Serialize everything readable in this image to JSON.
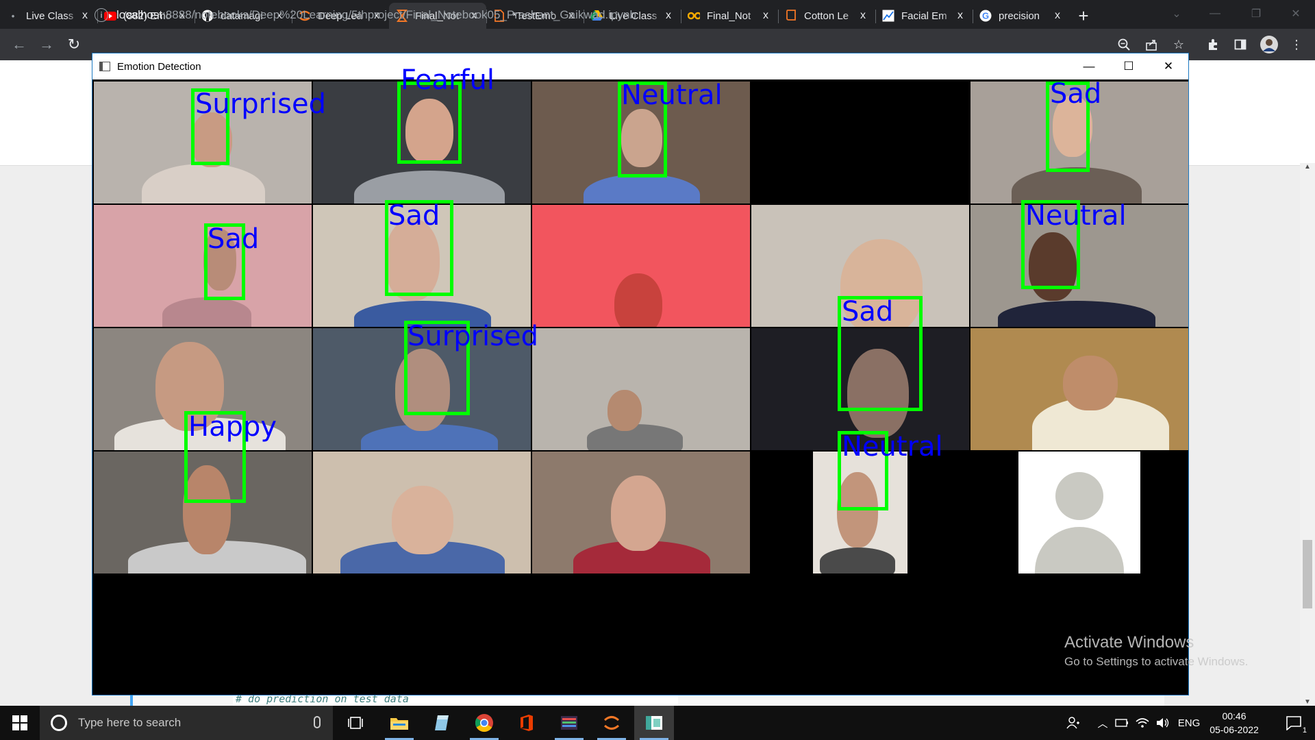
{
  "browser": {
    "tabs": [
      {
        "label": "Live Class",
        "icon": "live-class-icon"
      },
      {
        "label": "(882) Emo",
        "icon": "youtube-icon"
      },
      {
        "label": "datamagi",
        "icon": "github-icon"
      },
      {
        "label": "Deep Lea",
        "icon": "jupyter-icon"
      },
      {
        "label": "Final_Not",
        "icon": "jupyter-hourglass-icon",
        "active": true
      },
      {
        "label": "*TestEmo",
        "icon": "document-icon"
      },
      {
        "label": "Live Class",
        "icon": "google-drive-icon"
      },
      {
        "label": "Final_Not",
        "icon": "colab-icon"
      },
      {
        "label": "Cotton Le",
        "icon": "book-icon"
      },
      {
        "label": "Facial Em",
        "icon": "chart-icon"
      },
      {
        "label": "precision",
        "icon": "google-icon"
      }
    ],
    "new_tab_label": "+",
    "close_glyph": "x",
    "address_host": "localhost",
    "address_path": ":8888/notebooks/Deep%20Learning/5thproject/Final_Notebook05_Prashant_Gaikwad.ipynb"
  },
  "notebook": {
    "code_line": "# do prediction on test data"
  },
  "cv_window": {
    "title": "Emotion Detection",
    "detections": [
      {
        "label": "Surprised"
      },
      {
        "label": "Fearful"
      },
      {
        "label": "Neutral"
      },
      {
        "label": "Sad"
      },
      {
        "label": "Sad"
      },
      {
        "label": "Sad"
      },
      {
        "label": "Neutral"
      },
      {
        "label": "Sad"
      },
      {
        "label": "Surprised"
      },
      {
        "label": "Happy"
      },
      {
        "label": "Neutral"
      }
    ],
    "box_color": "#00ff00",
    "label_color": "#0000ff"
  },
  "watermark": {
    "line1": "Activate Windows",
    "line2": "Go to Settings to activate Windows."
  },
  "taskbar": {
    "search_placeholder": "Type here to search",
    "language": "ENG",
    "time": "00:46",
    "date": "05-06-2022",
    "notification_count": "1",
    "apps": [
      "task-view-icon",
      "file-explorer-icon",
      "notepad-icon",
      "chrome-icon",
      "office-icon",
      "media-app-icon",
      "jupyter-taskbar-icon",
      "python-window-icon"
    ]
  }
}
